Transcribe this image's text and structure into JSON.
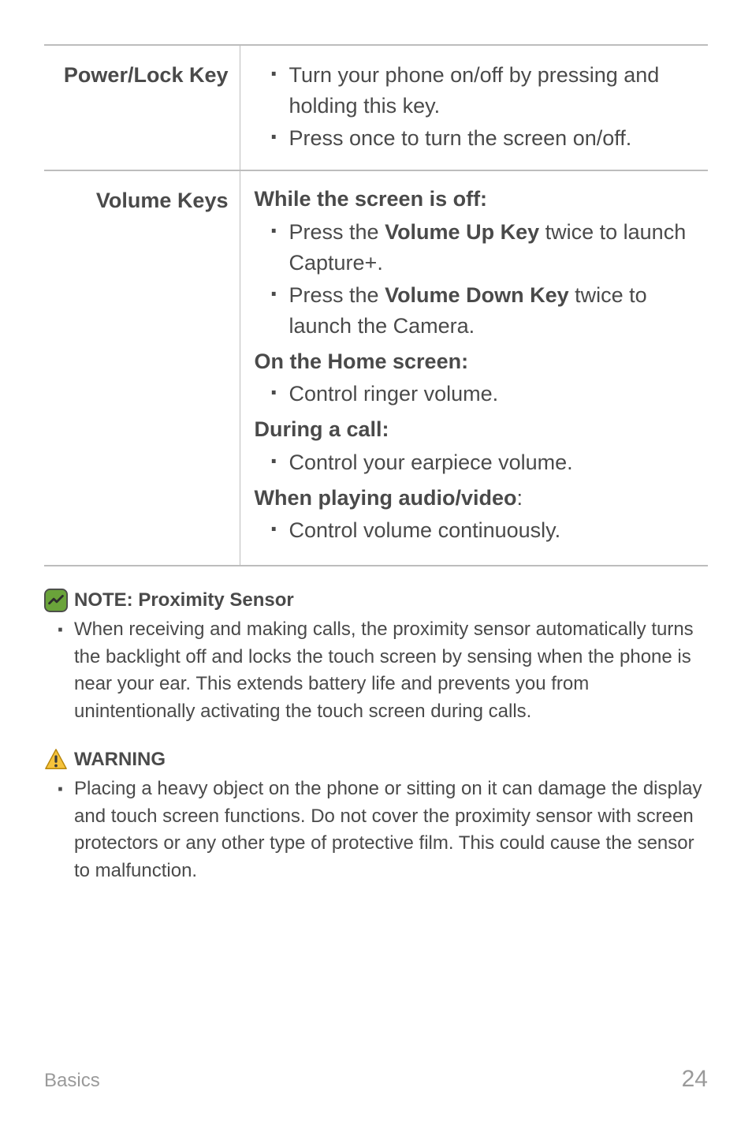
{
  "table": {
    "row1": {
      "label": "Power/Lock Key",
      "items": [
        "Turn your phone on/off by pressing and holding this key.",
        "Press once to turn the screen on/off."
      ]
    },
    "row2": {
      "label": "Volume Keys",
      "h1": "While the screen is off:",
      "i1_pre": "Press the ",
      "i1_bold": "Volume Up Key",
      "i1_post": " twice to launch Capture+.",
      "i2_pre": "Press the ",
      "i2_bold": "Volume Down Key",
      "i2_post": " twice to launch the Camera.",
      "h2": "On the Home screen:",
      "i3": "Control ringer volume.",
      "h3": "During a call:",
      "i4": "Control your earpiece volume.",
      "h4_pre": "When playing audio/video",
      "h4_post": ":",
      "i5": "Control volume continuously."
    }
  },
  "note": {
    "heading": "NOTE: Proximity Sensor",
    "body": "When receiving and making calls, the proximity sensor automatically turns the backlight off and locks the touch screen by sensing when the phone is near your ear. This extends battery life and prevents you from unintentionally activating the touch screen during calls."
  },
  "warning": {
    "heading": "WARNING",
    "body": "Placing a heavy object on the phone or sitting on it can damage the display and touch screen functions. Do not cover the proximity sensor with screen protectors or any other type of protective film. This could cause the sensor to malfunction."
  },
  "footer": {
    "section": "Basics",
    "page": "24"
  }
}
